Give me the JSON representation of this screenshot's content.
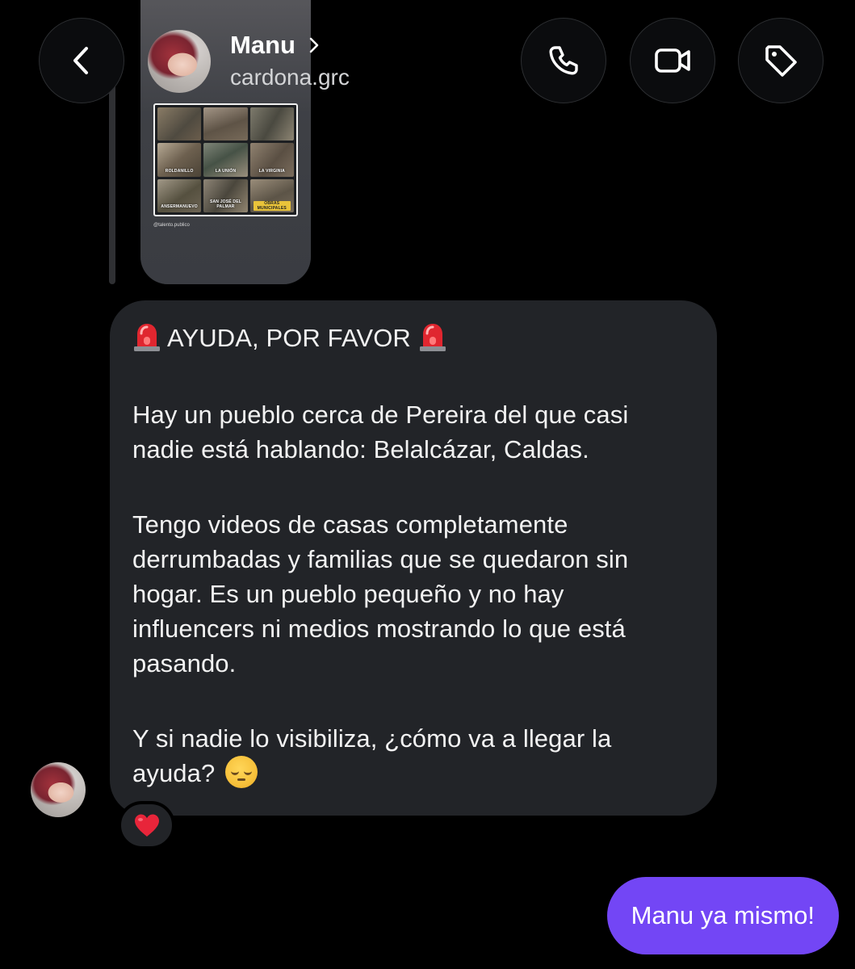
{
  "header": {
    "contact_name": "Manu",
    "contact_handle": "cardona.grc",
    "icons": {
      "back": "chevron-left-icon",
      "call": "phone-icon",
      "video": "video-camera-icon",
      "tag": "tag-icon"
    }
  },
  "story_preview": {
    "handle": "@talento.publico",
    "captions": [
      "ROLDANILLO",
      "LA UNIÓN",
      "LA VIRGINIA",
      "ANSERMANUEVO",
      "SAN JOSÉ DEL PALMAR",
      "OBRAS MUNICIPALES"
    ]
  },
  "received_message": {
    "title": "AYUDA, POR FAVOR",
    "paragraph1": [
      "Hay un pueblo cerca de Pereira del que casi",
      "nadie está hablando: Belalcázar, Caldas."
    ],
    "paragraph2": [
      "Tengo videos de casas completamente",
      "derrumbadas y familias que se quedaron sin",
      "hogar. Es un pueblo pequeño y no hay",
      "influencers ni medios mostrando lo que está",
      "pasando."
    ],
    "paragraph3": [
      "Y si nadie lo visibiliza, ¿cómo va a llegar la",
      "ayuda?"
    ],
    "emoji_siren": "siren-emoji",
    "emoji_end": "pensive-face-emoji",
    "reaction": "red-heart-emoji"
  },
  "sent_message": {
    "text": "Manu ya mismo!"
  },
  "colors": {
    "background": "#000000",
    "received_bubble": "#222428",
    "sent_bubble": "#7346f5",
    "reaction_heart": "#e8253a"
  }
}
